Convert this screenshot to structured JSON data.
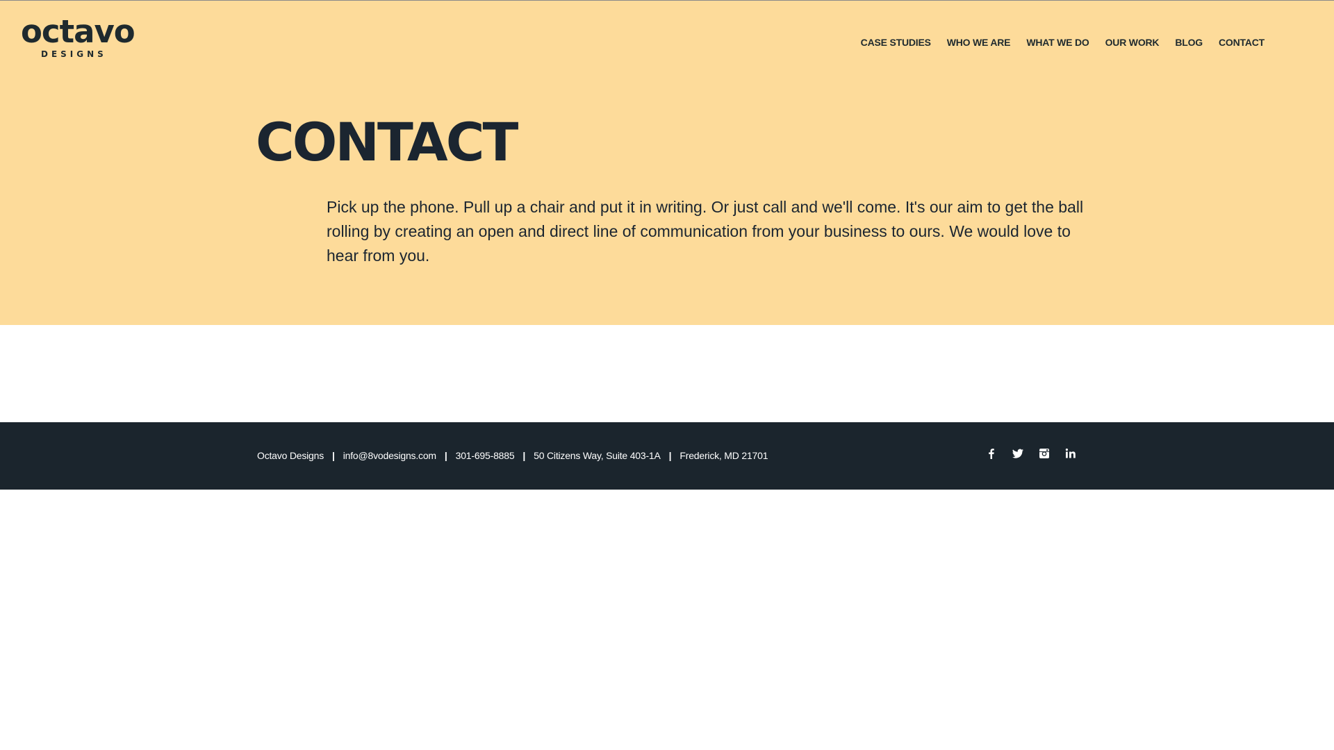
{
  "brand": {
    "name": "octavo",
    "tagline": "DESIGNS"
  },
  "nav": {
    "items": [
      {
        "label": "CASE STUDIES"
      },
      {
        "label": "WHO WE ARE"
      },
      {
        "label": "WHAT WE DO"
      },
      {
        "label": "OUR WORK"
      },
      {
        "label": "BLOG"
      },
      {
        "label": "CONTACT"
      }
    ]
  },
  "hero": {
    "title": "CONTACT",
    "intro": "Pick up the phone. Pull up a chair and put it in writing. Or just call and we'll come. It's our aim to get the ball rolling by creating an open and direct line of communication from your business to ours. We would love to hear from you."
  },
  "footer": {
    "company": "Octavo Designs",
    "email": "info@8vodesigns.com",
    "phone": "301-695-8885",
    "address": "50 Citizens Way, Suite 403-1A",
    "city": "Frederick, MD 21701",
    "separator": "|",
    "social": [
      {
        "icon": "facebook-icon"
      },
      {
        "icon": "twitter-icon"
      },
      {
        "icon": "instagram-icon"
      },
      {
        "icon": "linkedin-icon"
      }
    ]
  },
  "colors": {
    "hero_bg": "#fddb9a",
    "footer_bg": "#1b252d",
    "text_dark": "#1b2530"
  }
}
